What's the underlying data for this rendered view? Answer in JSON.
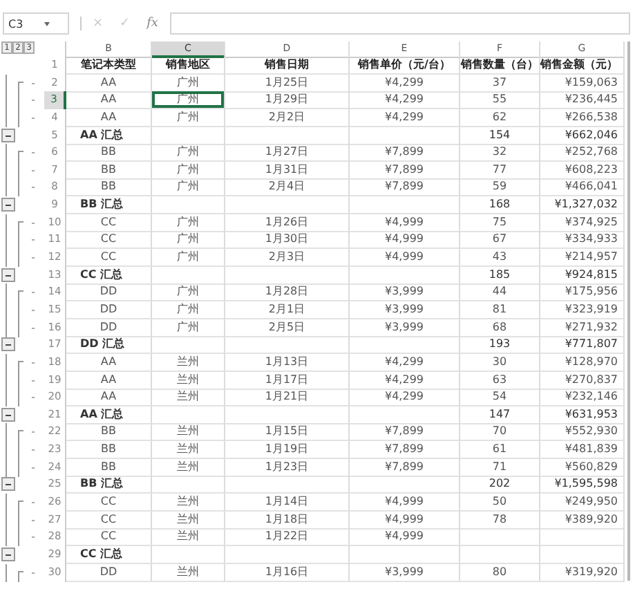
{
  "name_box": "C3",
  "formula_buttons": [
    "×",
    "✓",
    "fx"
  ],
  "outline_levels": [
    "1",
    "2",
    "3"
  ],
  "columns": [
    {
      "letter": "B",
      "selected": false
    },
    {
      "letter": "C",
      "selected": true
    },
    {
      "letter": "D",
      "selected": false
    },
    {
      "letter": "E",
      "selected": false
    },
    {
      "letter": "F",
      "selected": false
    },
    {
      "letter": "G",
      "selected": false
    }
  ],
  "rows": [
    {
      "number": "1",
      "kind": "header",
      "selected": false,
      "cells": [
        "笔记本类型",
        "销售地区",
        "销售日期",
        "销售单价（元/台）",
        "销售数量（台）",
        "销售金额（元）"
      ]
    },
    {
      "number": "2",
      "kind": "detail",
      "selected": false,
      "cells": [
        "AA",
        "广州",
        "1月25日",
        "¥4,299",
        "37",
        "¥159,063"
      ]
    },
    {
      "number": "3",
      "kind": "detail",
      "selected": true,
      "cells": [
        "AA",
        "广州",
        "1月29日",
        "¥4,299",
        "55",
        "¥236,445"
      ]
    },
    {
      "number": "4",
      "kind": "detail",
      "selected": false,
      "cells": [
        "AA",
        "广州",
        "2月2日",
        "¥4,299",
        "62",
        "¥266,538"
      ]
    },
    {
      "number": "5",
      "kind": "subtotal",
      "selected": false,
      "cells": [
        "AA 汇总",
        "",
        "",
        "",
        "154",
        "¥662,046"
      ]
    },
    {
      "number": "6",
      "kind": "detail",
      "selected": false,
      "cells": [
        "BB",
        "广州",
        "1月27日",
        "¥7,899",
        "32",
        "¥252,768"
      ]
    },
    {
      "number": "7",
      "kind": "detail",
      "selected": false,
      "cells": [
        "BB",
        "广州",
        "1月31日",
        "¥7,899",
        "77",
        "¥608,223"
      ]
    },
    {
      "number": "8",
      "kind": "detail",
      "selected": false,
      "cells": [
        "BB",
        "广州",
        "2月4日",
        "¥7,899",
        "59",
        "¥466,041"
      ]
    },
    {
      "number": "9",
      "kind": "subtotal",
      "selected": false,
      "cells": [
        "BB 汇总",
        "",
        "",
        "",
        "168",
        "¥1,327,032"
      ]
    },
    {
      "number": "10",
      "kind": "detail",
      "selected": false,
      "cells": [
        "CC",
        "广州",
        "1月26日",
        "¥4,999",
        "75",
        "¥374,925"
      ]
    },
    {
      "number": "11",
      "kind": "detail",
      "selected": false,
      "cells": [
        "CC",
        "广州",
        "1月30日",
        "¥4,999",
        "67",
        "¥334,933"
      ]
    },
    {
      "number": "12",
      "kind": "detail",
      "selected": false,
      "cells": [
        "CC",
        "广州",
        "2月3日",
        "¥4,999",
        "43",
        "¥214,957"
      ]
    },
    {
      "number": "13",
      "kind": "subtotal",
      "selected": false,
      "cells": [
        "CC 汇总",
        "",
        "",
        "",
        "185",
        "¥924,815"
      ]
    },
    {
      "number": "14",
      "kind": "detail",
      "selected": false,
      "cells": [
        "DD",
        "广州",
        "1月28日",
        "¥3,999",
        "44",
        "¥175,956"
      ]
    },
    {
      "number": "15",
      "kind": "detail",
      "selected": false,
      "cells": [
        "DD",
        "广州",
        "2月1日",
        "¥3,999",
        "81",
        "¥323,919"
      ]
    },
    {
      "number": "16",
      "kind": "detail",
      "selected": false,
      "cells": [
        "DD",
        "广州",
        "2月5日",
        "¥3,999",
        "68",
        "¥271,932"
      ]
    },
    {
      "number": "17",
      "kind": "subtotal",
      "selected": false,
      "cells": [
        "DD 汇总",
        "",
        "",
        "",
        "193",
        "¥771,807"
      ]
    },
    {
      "number": "18",
      "kind": "detail",
      "selected": false,
      "cells": [
        "AA",
        "兰州",
        "1月13日",
        "¥4,299",
        "30",
        "¥128,970"
      ]
    },
    {
      "number": "19",
      "kind": "detail",
      "selected": false,
      "cells": [
        "AA",
        "兰州",
        "1月17日",
        "¥4,299",
        "63",
        "¥270,837"
      ]
    },
    {
      "number": "20",
      "kind": "detail",
      "selected": false,
      "cells": [
        "AA",
        "兰州",
        "1月21日",
        "¥4,299",
        "54",
        "¥232,146"
      ]
    },
    {
      "number": "21",
      "kind": "subtotal",
      "selected": false,
      "cells": [
        "AA 汇总",
        "",
        "",
        "",
        "147",
        "¥631,953"
      ]
    },
    {
      "number": "22",
      "kind": "detail",
      "selected": false,
      "cells": [
        "BB",
        "兰州",
        "1月15日",
        "¥7,899",
        "70",
        "¥552,930"
      ]
    },
    {
      "number": "23",
      "kind": "detail",
      "selected": false,
      "cells": [
        "BB",
        "兰州",
        "1月19日",
        "¥7,899",
        "61",
        "¥481,839"
      ]
    },
    {
      "number": "24",
      "kind": "detail",
      "selected": false,
      "cells": [
        "BB",
        "兰州",
        "1月23日",
        "¥7,899",
        "71",
        "¥560,829"
      ]
    },
    {
      "number": "25",
      "kind": "subtotal",
      "selected": false,
      "cells": [
        "BB 汇总",
        "",
        "",
        "",
        "202",
        "¥1,595,598"
      ]
    },
    {
      "number": "26",
      "kind": "detail",
      "selected": false,
      "cells": [
        "CC",
        "兰州",
        "1月14日",
        "¥4,999",
        "50",
        "¥249,950"
      ]
    },
    {
      "number": "27",
      "kind": "detail",
      "selected": false,
      "cells": [
        "CC",
        "兰州",
        "1月18日",
        "¥4,999",
        "78",
        "¥389,920"
      ]
    },
    {
      "number": "28",
      "kind": "detail",
      "selected": false,
      "cells": [
        "CC",
        "兰州",
        "1月22日",
        "¥4,999",
        "",
        ""
      ]
    },
    {
      "number": "29",
      "kind": "subtotal",
      "selected": false,
      "cells": [
        "CC 汇总",
        "",
        "",
        "",
        "",
        ""
      ]
    },
    {
      "number": "30",
      "kind": "detail",
      "selected": false,
      "cells": [
        "DD",
        "兰州",
        "1月16日",
        "¥3,999",
        "80",
        "¥319,920"
      ]
    }
  ]
}
